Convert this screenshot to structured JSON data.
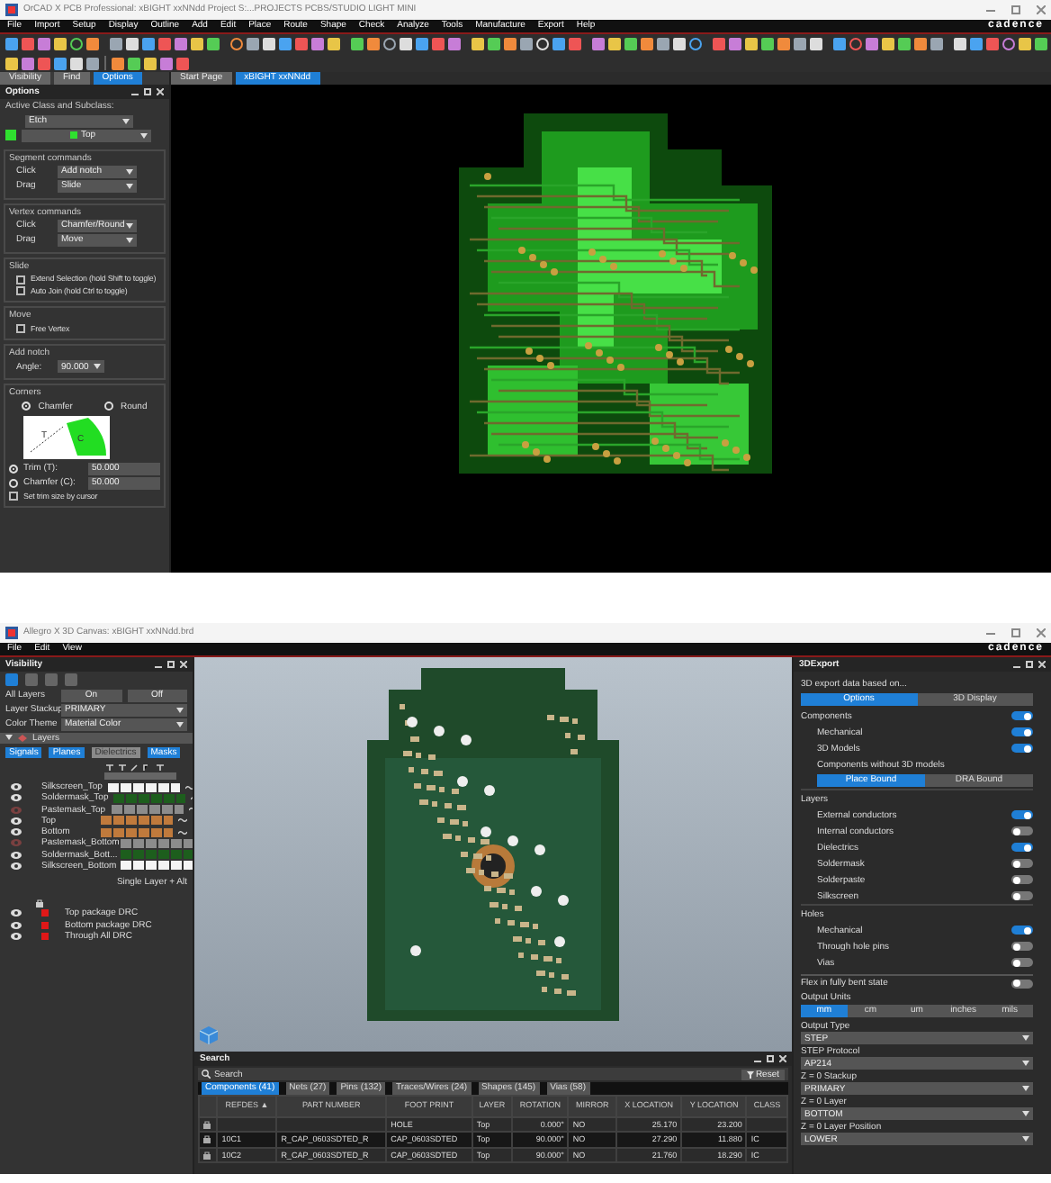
{
  "top_window": {
    "title": "OrCAD X PCB Professional: xBIGHT xxNNdd Project S:...PROJECTS PCBS/STUDIO LIGHT MINI",
    "menu": [
      "File",
      "Import",
      "Setup",
      "Display",
      "Outline",
      "Add",
      "Edit",
      "Place",
      "Route",
      "Shape",
      "Check",
      "Analyze",
      "Tools",
      "Manufacture",
      "Export",
      "Help"
    ],
    "brand": "cadence",
    "panel_tabs": [
      {
        "label": "Visibility",
        "selected": false
      },
      {
        "label": "Find",
        "selected": false
      },
      {
        "label": "Options",
        "selected": true
      }
    ],
    "doc_tabs": [
      {
        "label": "Start Page",
        "selected": false
      },
      {
        "label": "xBIGHT xxNNdd",
        "selected": true
      }
    ],
    "options": {
      "title": "Options",
      "sections": [
        {
          "kind": "class",
          "title": "Active Class and Subclass:",
          "class": "Etch",
          "subclass": "Top"
        },
        {
          "kind": "dropdowns",
          "title": "Segment commands",
          "rows": [
            {
              "label": "Click",
              "value": "Add notch"
            },
            {
              "label": "Drag",
              "value": "Slide"
            }
          ]
        },
        {
          "kind": "dropdowns",
          "title": "Vertex commands",
          "rows": [
            {
              "label": "Click",
              "value": "Chamfer/Round"
            },
            {
              "label": "Drag",
              "value": "Move"
            }
          ]
        },
        {
          "kind": "checks",
          "title": "Slide",
          "rows": [
            {
              "label": "Extend Selection (hold Shift to toggle)",
              "checked": false
            },
            {
              "label": "Auto Join (hold Ctrl to toggle)",
              "checked": false
            }
          ]
        },
        {
          "kind": "checks",
          "title": "Move",
          "rows": [
            {
              "label": "Free Vertex",
              "checked": false
            }
          ]
        },
        {
          "kind": "angle",
          "title": "Add notch",
          "label": "Angle:",
          "value": "90.000"
        },
        {
          "kind": "corners",
          "title": "Corners",
          "radios": [
            {
              "label": "Chamfer",
              "selected": true
            },
            {
              "label": "Round",
              "selected": false
            }
          ],
          "diagram_labels": [
            "T",
            "C"
          ],
          "trims": [
            {
              "label": "Trim (T):",
              "value": "50.000",
              "selected": true
            },
            {
              "label": "Chamfer (C):",
              "value": "50.000",
              "selected": false
            }
          ],
          "check": {
            "label": "Set trim size by cursor",
            "checked": false
          }
        }
      ]
    }
  },
  "bottom_window": {
    "title": "Allegro X 3D Canvas: xBIGHT xxNNdd.brd",
    "menu": [
      "File",
      "Edit",
      "View"
    ],
    "brand": "cadence",
    "visibility": {
      "title": "Visibility",
      "all_layers": "All Layers",
      "buttons": [
        "On",
        "Off"
      ],
      "fields": [
        {
          "label": "Layer Stackup",
          "value": "PRIMARY"
        },
        {
          "label": "Color Theme",
          "value": "Material Color"
        }
      ],
      "layers_header": "Layers",
      "filters": [
        {
          "label": "Signals",
          "selected": true
        },
        {
          "label": "Planes",
          "selected": true
        },
        {
          "label": "Dielectrics",
          "selected": false
        },
        {
          "label": "Masks",
          "selected": true
        }
      ],
      "layers": [
        {
          "name": "Silkscreen_Top",
          "visible": true,
          "color": "#f4f4f4"
        },
        {
          "name": "Soldermask_Top",
          "visible": true,
          "color": "#1d5e1d"
        },
        {
          "name": "Pastemask_Top",
          "visible": false,
          "color": "#8c8c8c"
        },
        {
          "name": "Top",
          "visible": true,
          "color": "#c07a3c"
        },
        {
          "name": "Bottom",
          "visible": true,
          "color": "#c07a3c"
        },
        {
          "name": "Pastemask_Bottom",
          "visible": false,
          "color": "#8c8c8c"
        },
        {
          "name": "Soldermask_Bott...",
          "visible": true,
          "color": "#1d5e1d"
        },
        {
          "name": "Silkscreen_Bottom",
          "visible": true,
          "color": "#f4f4f4"
        }
      ],
      "hint": "Single Layer + Alt",
      "drc": [
        {
          "name": "Top package DRC",
          "visible": true
        },
        {
          "name": "Bottom package DRC",
          "visible": true
        },
        {
          "name": "Through All DRC",
          "visible": true
        }
      ]
    },
    "search": {
      "title": "Search",
      "placeholder": "Search",
      "reset": "Reset",
      "tabs": [
        {
          "label": "Components (41)",
          "selected": true
        },
        {
          "label": "Nets (27)",
          "selected": false
        },
        {
          "label": "Pins (132)",
          "selected": false
        },
        {
          "label": "Traces/Wires (24)",
          "selected": false
        },
        {
          "label": "Shapes (145)",
          "selected": false
        },
        {
          "label": "Vias (58)",
          "selected": false
        }
      ],
      "columns": [
        "REFDES ▲",
        "PART NUMBER",
        "FOOT PRINT",
        "LAYER",
        "ROTATION",
        "MIRROR",
        "X LOCATION",
        "Y LOCATION",
        "CLASS"
      ],
      "rows": [
        {
          "cells": [
            "",
            "",
            "HOLE",
            "Top",
            "0.000°",
            "NO",
            "25.170",
            "23.200",
            ""
          ],
          "selected": false
        },
        {
          "cells": [
            "10C1",
            "R_CAP_0603SDTED_R",
            "CAP_0603SDTED",
            "Top",
            "90.000°",
            "NO",
            "27.290",
            "11.880",
            "IC"
          ],
          "selected": true
        },
        {
          "cells": [
            "10C2",
            "R_CAP_0603SDTED_R",
            "CAP_0603SDTED",
            "Top",
            "90.000°",
            "NO",
            "21.760",
            "18.290",
            "IC"
          ],
          "selected": false
        }
      ]
    },
    "export": {
      "title": "3DExport",
      "intro": "3D export data based on...",
      "modes": [
        {
          "label": "Options",
          "selected": true
        },
        {
          "label": "3D Display",
          "selected": false
        }
      ],
      "items": [
        {
          "kind": "toggle",
          "label": "Components",
          "on": true,
          "indent": false
        },
        {
          "kind": "toggle",
          "label": "Mechanical",
          "on": true,
          "indent": true
        },
        {
          "kind": "toggle",
          "label": "3D Models",
          "on": true,
          "indent": true
        },
        {
          "kind": "text",
          "label": "Components without 3D models"
        },
        {
          "kind": "segment",
          "options": [
            {
              "label": "Place Bound",
              "selected": true
            },
            {
              "label": "DRA Bound",
              "selected": false
            }
          ]
        },
        {
          "kind": "header",
          "label": "Layers"
        },
        {
          "kind": "toggle",
          "label": "External conductors",
          "on": true,
          "indent": true
        },
        {
          "kind": "toggle",
          "label": "Internal conductors",
          "on": false,
          "indent": true
        },
        {
          "kind": "toggle",
          "label": "Dielectrics",
          "on": true,
          "indent": true
        },
        {
          "kind": "toggle",
          "label": "Soldermask",
          "on": false,
          "indent": true
        },
        {
          "kind": "toggle",
          "label": "Solderpaste",
          "on": false,
          "indent": true
        },
        {
          "kind": "toggle",
          "label": "Silkscreen",
          "on": false,
          "indent": true
        },
        {
          "kind": "header",
          "label": "Holes"
        },
        {
          "kind": "toggle",
          "label": "Mechanical",
          "on": true,
          "indent": true
        },
        {
          "kind": "toggle",
          "label": "Through hole pins",
          "on": false,
          "indent": true
        },
        {
          "kind": "toggle",
          "label": "Vias",
          "on": false,
          "indent": true
        },
        {
          "kind": "toggle",
          "label": "Flex in fully bent state",
          "on": false,
          "indent": false,
          "rule": true
        },
        {
          "kind": "label",
          "label": "Output Units"
        },
        {
          "kind": "segment",
          "options": [
            {
              "label": "mm",
              "selected": true
            },
            {
              "label": "cm",
              "selected": false
            },
            {
              "label": "um",
              "selected": false
            },
            {
              "label": "inches",
              "selected": false
            },
            {
              "label": "mils",
              "selected": false
            }
          ]
        },
        {
          "kind": "dropdown",
          "label": "Output Type",
          "value": "STEP"
        },
        {
          "kind": "dropdown",
          "label": "STEP Protocol",
          "value": "AP214"
        },
        {
          "kind": "dropdown",
          "label": "Z = 0 Stackup",
          "value": "PRIMARY"
        },
        {
          "kind": "dropdown",
          "label": "Z = 0 Layer",
          "value": "BOTTOM"
        },
        {
          "kind": "dropdown",
          "label": "Z = 0 Layer Position",
          "value": "LOWER"
        }
      ]
    }
  }
}
